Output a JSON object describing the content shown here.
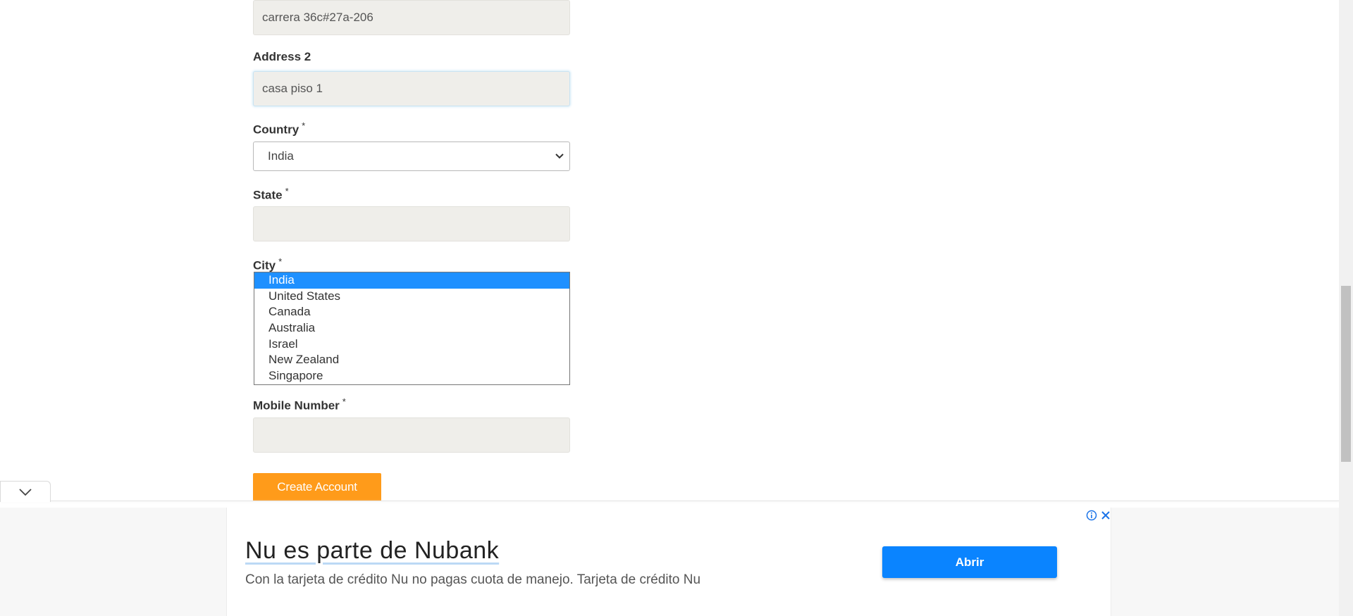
{
  "form": {
    "address1": {
      "value": "carrera 36c#27a-206"
    },
    "address2": {
      "label": "Address 2",
      "value": "casa piso 1"
    },
    "country": {
      "label": "Country",
      "required_mark": "*",
      "selected": "India"
    },
    "state": {
      "label": "State",
      "required_mark": "*",
      "value": ""
    },
    "city": {
      "label": "City",
      "required_mark": "*"
    },
    "country_options": [
      "India",
      "United States",
      "Canada",
      "Australia",
      "Israel",
      "New Zealand",
      "Singapore"
    ],
    "mobile": {
      "label": "Mobile Number",
      "required_mark": "*",
      "value": ""
    },
    "submit_label": "Create Account"
  },
  "ad": {
    "title": "Nu es parte de Nubank",
    "description": "Con la tarjeta de crédito Nu no pagas cuota de manejo. Tarjeta de crédito Nu",
    "button_label": "Abrir",
    "info_icon": "info-icon",
    "close_icon": "close-icon",
    "collapse_icon": "chevron-down-icon"
  },
  "colors": {
    "accent_orange": "#ff9b1a",
    "ad_button_blue": "#0a84ff",
    "selected_option_blue": "#1e90ff",
    "input_bg": "#efeeea"
  }
}
